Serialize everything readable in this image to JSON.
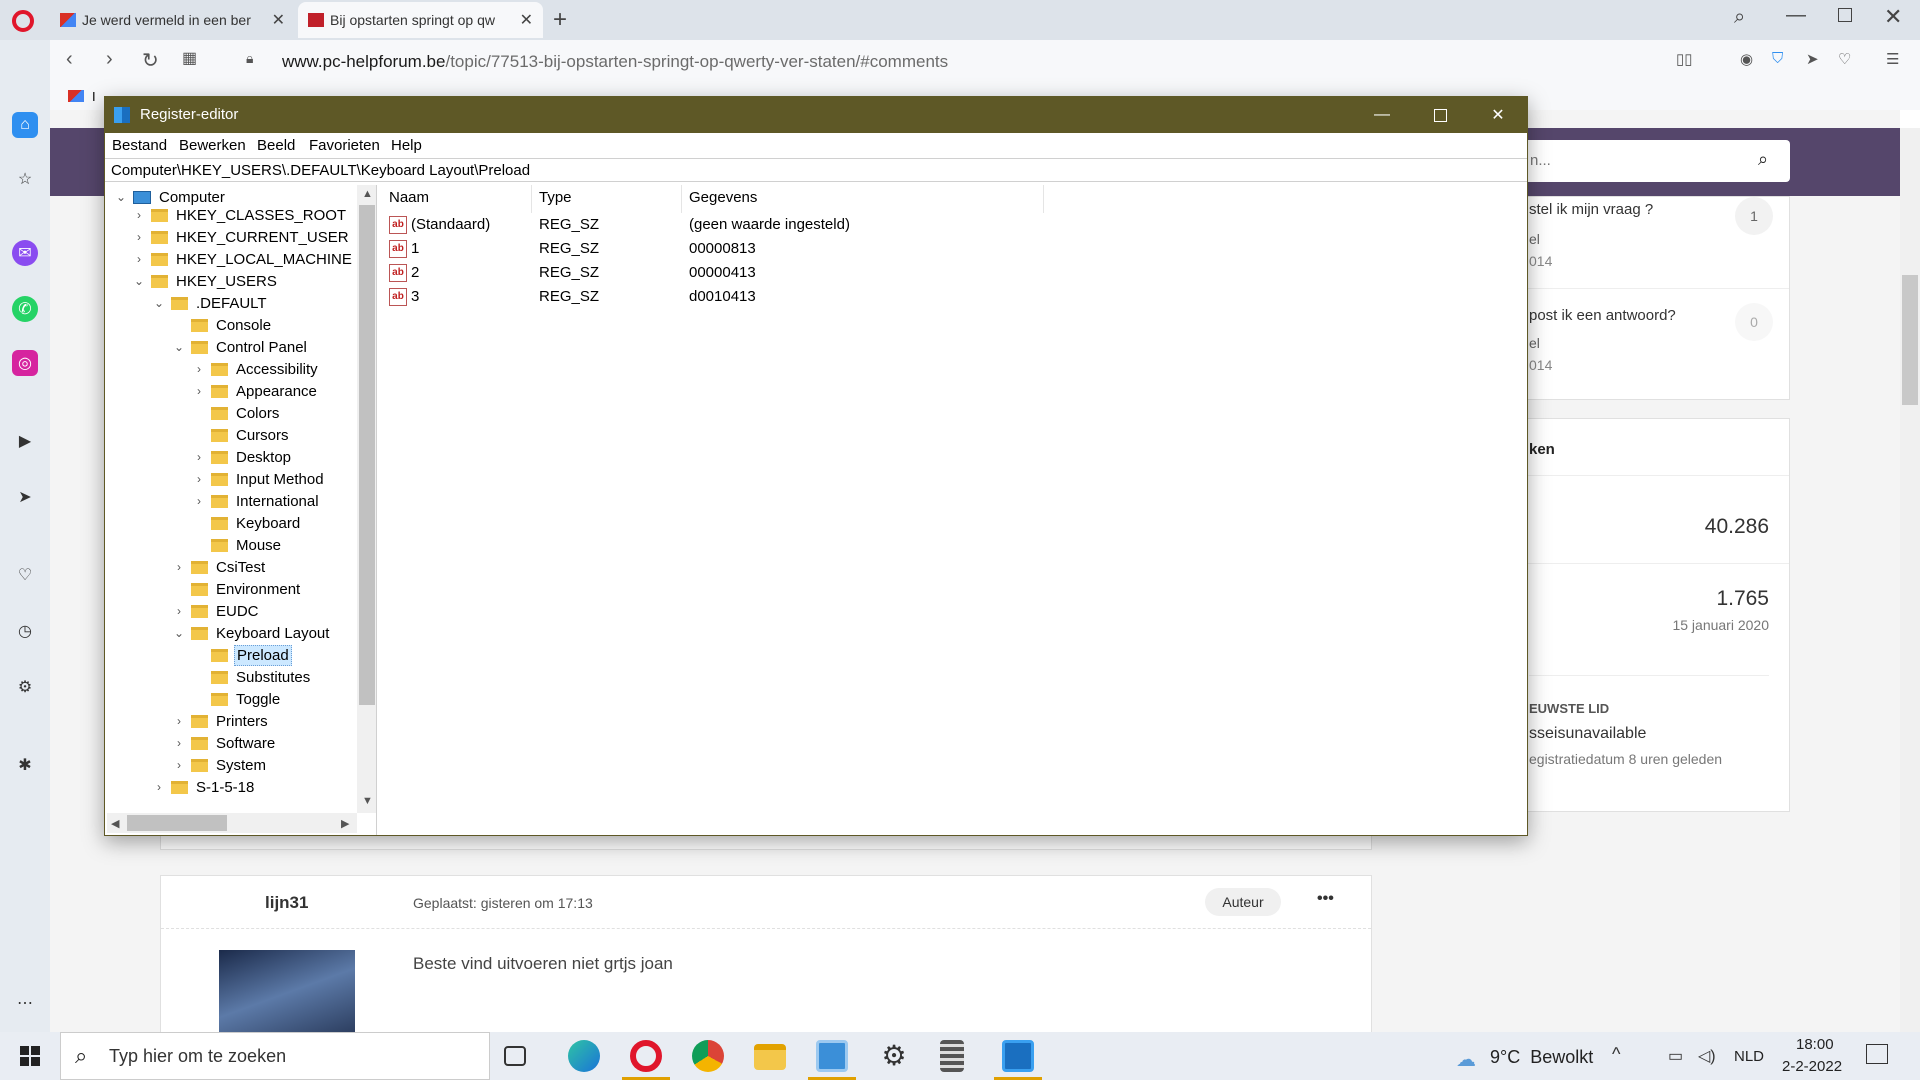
{
  "browser": {
    "tabs": [
      {
        "title": "Je werd vermeld in een ber",
        "active": false
      },
      {
        "title": "Bij opstarten springt op qw",
        "active": true
      }
    ],
    "address": {
      "domain": "www.pc-helpforum.be",
      "path": "/topic/77513-bij-opstarten-springt-op-qwerty-ver-staten/#comments"
    },
    "bookmarks_first": "I"
  },
  "page": {
    "search_placeholder": "n...",
    "sidebar_items": [
      {
        "title": "stel ik mijn vraag ?",
        "sub1": "el",
        "sub2": "014",
        "count": "1"
      },
      {
        "title": "post ik een antwoord?",
        "sub1": "el",
        "sub2": "014",
        "count": "0"
      }
    ],
    "stats_title": "ken",
    "stat1": "40.286",
    "stat2": "1.765",
    "stat2_date": "15 januari 2020",
    "newest_label": "EUWSTE LID",
    "newest_name": "sseisunavailable",
    "newest_date": "egistratiedatum 8 uren geleden",
    "post": {
      "author": "lijn31",
      "posted": "Geplaatst: gisteren om 17:13",
      "badge": "Auteur",
      "more": "•••",
      "body": "Beste vind uitvoeren niet grtjs joan"
    }
  },
  "regedit": {
    "title": "Register-editor",
    "menu": [
      "Bestand",
      "Bewerken",
      "Beeld",
      "Favorieten",
      "Help"
    ],
    "address": "Computer\\HKEY_USERS\\.DEFAULT\\Keyboard Layout\\Preload",
    "tree": [
      {
        "label": "Computer",
        "exp": "v"
      },
      {
        "label": "HKEY_CLASSES_ROOT",
        "exp": ">"
      },
      {
        "label": "HKEY_CURRENT_USER",
        "exp": ">"
      },
      {
        "label": "HKEY_LOCAL_MACHINE",
        "exp": ">"
      },
      {
        "label": "HKEY_USERS",
        "exp": "v"
      },
      {
        "label": ".DEFAULT",
        "exp": "v"
      },
      {
        "label": "Console",
        "exp": ""
      },
      {
        "label": "Control Panel",
        "exp": "v"
      },
      {
        "label": "Accessibility",
        "exp": ">"
      },
      {
        "label": "Appearance",
        "exp": ">"
      },
      {
        "label": "Colors",
        "exp": ""
      },
      {
        "label": "Cursors",
        "exp": ""
      },
      {
        "label": "Desktop",
        "exp": ">"
      },
      {
        "label": "Input Method",
        "exp": ">"
      },
      {
        "label": "International",
        "exp": ">"
      },
      {
        "label": "Keyboard",
        "exp": ""
      },
      {
        "label": "Mouse",
        "exp": ""
      },
      {
        "label": "CsiTest",
        "exp": ">"
      },
      {
        "label": "Environment",
        "exp": ""
      },
      {
        "label": "EUDC",
        "exp": ">"
      },
      {
        "label": "Keyboard Layout",
        "exp": "v"
      },
      {
        "label": "Preload",
        "exp": ""
      },
      {
        "label": "Substitutes",
        "exp": ""
      },
      {
        "label": "Toggle",
        "exp": ""
      },
      {
        "label": "Printers",
        "exp": ">"
      },
      {
        "label": "Software",
        "exp": ">"
      },
      {
        "label": "System",
        "exp": ">"
      },
      {
        "label": "S-1-5-18",
        "exp": ">"
      }
    ],
    "columns": [
      "Naam",
      "Type",
      "Gegevens"
    ],
    "values": [
      {
        "name": "(Standaard)",
        "type": "REG_SZ",
        "data": "(geen waarde ingesteld)"
      },
      {
        "name": "1",
        "type": "REG_SZ",
        "data": "00000813"
      },
      {
        "name": "2",
        "type": "REG_SZ",
        "data": "00000413"
      },
      {
        "name": "3",
        "type": "REG_SZ",
        "data": "d0010413"
      }
    ]
  },
  "taskbar": {
    "search_placeholder": "Typ hier om te zoeken",
    "weather": "9°C  Bewolkt",
    "language": "NLD",
    "time": "18:00",
    "date": "2-2-2022"
  },
  "colors": {
    "regedit_title": "#5e5826",
    "banner": "#55466b",
    "selection": "#cce8ff"
  }
}
